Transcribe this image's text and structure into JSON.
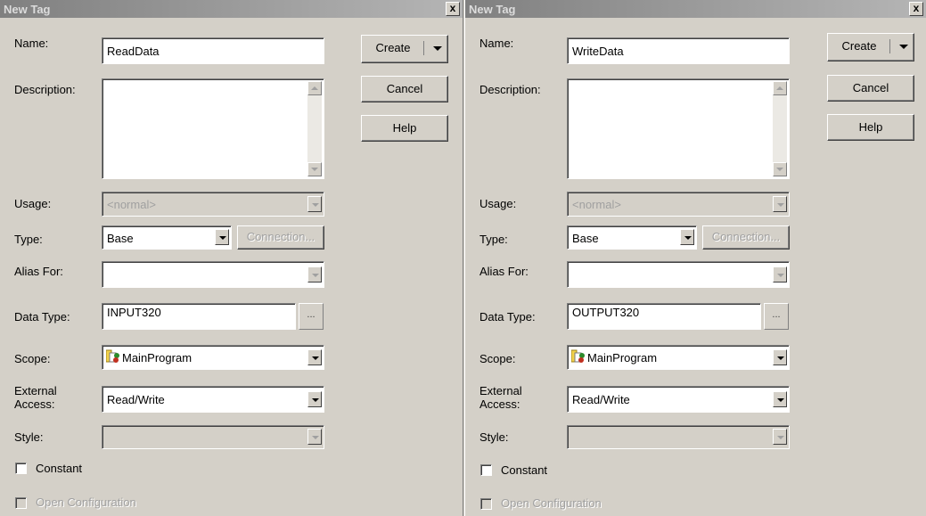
{
  "dialogs": [
    {
      "title": "New Tag",
      "close_label": "x",
      "labels": {
        "name": "Name:",
        "description": "Description:",
        "usage": "Usage:",
        "type": "Type:",
        "alias_for": "Alias For:",
        "data_type": "Data Type:",
        "scope": "Scope:",
        "external_access_line1": "External",
        "external_access_line2": "Access:",
        "style": "Style:"
      },
      "fields": {
        "name_value": "ReadData",
        "description_value": "",
        "usage_value": "<normal>",
        "type_value": "Base",
        "alias_for_value": "",
        "data_type_value": "INPUT320",
        "scope_value": "MainProgram",
        "external_access_value": "Read/Write",
        "style_value": ""
      },
      "buttons": {
        "create": "Create",
        "cancel": "Cancel",
        "help": "Help",
        "connection": "Connection...",
        "browse": "..."
      },
      "checkboxes": {
        "constant": "Constant",
        "open_configuration": "Open Configuration"
      }
    },
    {
      "title": "New Tag",
      "close_label": "x",
      "labels": {
        "name": "Name:",
        "description": "Description:",
        "usage": "Usage:",
        "type": "Type:",
        "alias_for": "Alias For:",
        "data_type": "Data Type:",
        "scope": "Scope:",
        "external_access_line1": "External",
        "external_access_line2": "Access:",
        "style": "Style:"
      },
      "fields": {
        "name_value": "WriteData",
        "description_value": "",
        "usage_value": "<normal>",
        "type_value": "Base",
        "alias_for_value": "",
        "data_type_value": "OUTPUT320",
        "scope_value": "MainProgram",
        "external_access_value": "Read/Write",
        "style_value": ""
      },
      "buttons": {
        "create": "Create",
        "cancel": "Cancel",
        "help": "Help",
        "connection": "Connection...",
        "browse": "..."
      },
      "checkboxes": {
        "constant": "Constant",
        "open_configuration": "Open Configuration"
      }
    }
  ],
  "icons": {
    "close": "close-icon",
    "dropdown": "chevron-down-icon",
    "scope": "program-folder-icon"
  },
  "colors": {
    "dialog_bg": "#d4d0c8",
    "title_text": "#dcdcdc",
    "disabled_text": "#a0a0a0"
  }
}
